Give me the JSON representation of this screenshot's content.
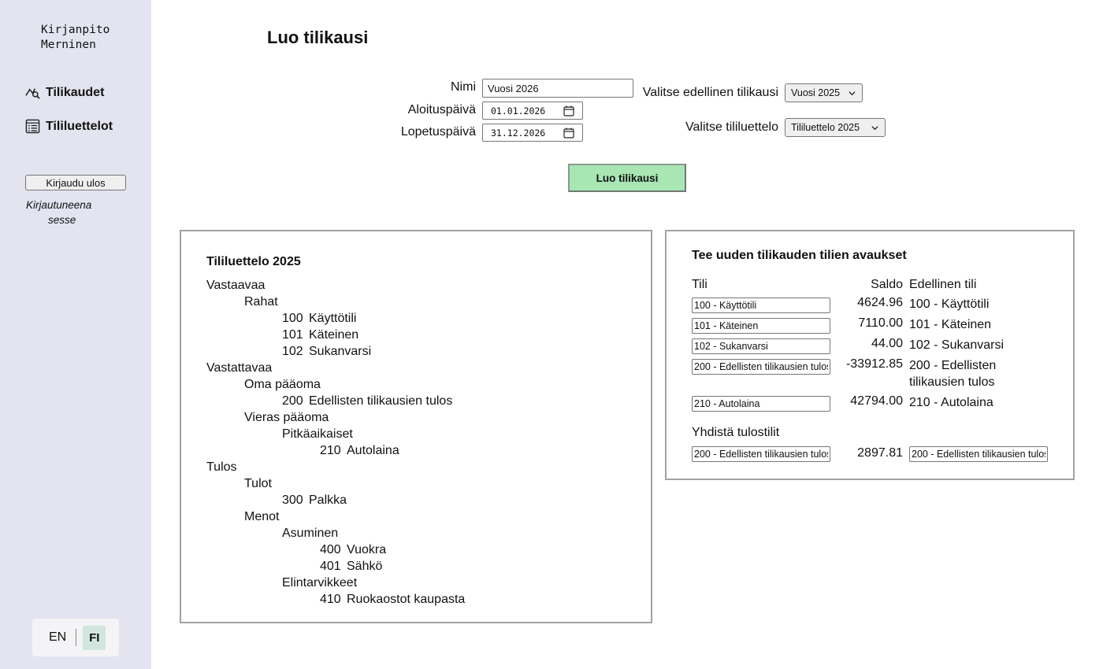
{
  "sidebar": {
    "brand_line1": "Kirjanpito",
    "brand_line2": "Merninen",
    "nav": [
      {
        "label": "Tilikaudet",
        "icon": "chart-search-icon"
      },
      {
        "label": "Tililuettelot",
        "icon": "list-icon"
      }
    ],
    "logout_label": "Kirjaudu ulos",
    "logged_in_label": "Kirjautuneena",
    "username": "sesse",
    "languages": {
      "en": "EN",
      "fi": "FI",
      "active": "FI"
    }
  },
  "form": {
    "title": "Luo tilikausi",
    "name_label": "Nimi",
    "name_value": "Vuosi 2026",
    "start_label": "Aloituspäivä",
    "start_value": "01.01.2026",
    "end_label": "Lopetuspäivä",
    "end_value": "31.12.2026",
    "prev_period_label": "Valitse edellinen tilikausi",
    "prev_period_value": "Vuosi 2025",
    "account_list_label": "Valitse tililuettelo",
    "account_list_value": "Tililuettelo 2025",
    "submit_label": "Luo tilikausi"
  },
  "account_tree": {
    "title": "Tililuettelo 2025",
    "rows": [
      {
        "level": 0,
        "text": "Vastaavaa"
      },
      {
        "level": 1,
        "text": "Rahat"
      },
      {
        "level": 2,
        "num": "100",
        "text": "Käyttötili"
      },
      {
        "level": 2,
        "num": "101",
        "text": "Käteinen"
      },
      {
        "level": 2,
        "num": "102",
        "text": "Sukanvarsi"
      },
      {
        "level": 0,
        "text": "Vastattavaa"
      },
      {
        "level": 1,
        "text": "Oma pääoma"
      },
      {
        "level": 2,
        "num": "200",
        "text": "Edellisten tilikausien tulos"
      },
      {
        "level": 1,
        "text": "Vieras pääoma"
      },
      {
        "level": 2,
        "text": "Pitkäaikaiset"
      },
      {
        "level": 3,
        "num": "210",
        "text": "Autolaina"
      },
      {
        "level": 0,
        "text": "Tulos"
      },
      {
        "level": 1,
        "text": "Tulot"
      },
      {
        "level": 2,
        "num": "300",
        "text": "Palkka"
      },
      {
        "level": 1,
        "text": "Menot"
      },
      {
        "level": 2,
        "text": "Asuminen"
      },
      {
        "level": 3,
        "num": "400",
        "text": "Vuokra"
      },
      {
        "level": 3,
        "num": "401",
        "text": "Sähkö"
      },
      {
        "level": 2,
        "text": "Elintarvikkeet"
      },
      {
        "level": 3,
        "num": "410",
        "text": "Ruokaostot kaupasta"
      }
    ]
  },
  "openings": {
    "title": "Tee uuden tilikauden tilien avaukset",
    "headers": {
      "account": "Tili",
      "balance": "Saldo",
      "previous": "Edellinen tili"
    },
    "rows": [
      {
        "account": "100 - Käyttötili",
        "balance": "4624.96",
        "previous": "100 - Käyttötili"
      },
      {
        "account": "101 - Käteinen",
        "balance": "7110.00",
        "previous": "101 - Käteinen"
      },
      {
        "account": "102 - Sukanvarsi",
        "balance": "44.00",
        "previous": "102 - Sukanvarsi"
      },
      {
        "account": "200 - Edellisten tilikausien tulos",
        "balance": "-33912.85",
        "previous": "200 - Edellisten tilikausien tulos"
      },
      {
        "account": "210 - Autolaina",
        "balance": "42794.00",
        "previous": "210 - Autolaina"
      }
    ],
    "merge_label": "Yhdistä tulostilit",
    "merge_row": {
      "account": "200 - Edellisten tilikausien tulos",
      "balance": "2897.81",
      "previous": "200 - Edellisten tilikausien tulos"
    }
  }
}
